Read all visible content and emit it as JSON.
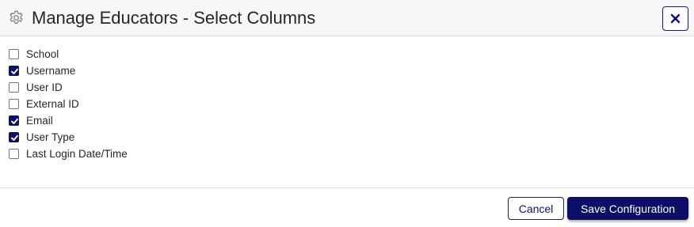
{
  "dialog": {
    "title": "Manage Educators - Select Columns",
    "title_icon": "gear-icon",
    "close_icon": "close-icon"
  },
  "columns": [
    {
      "label": "School",
      "checked": false
    },
    {
      "label": "Username",
      "checked": true
    },
    {
      "label": "User ID",
      "checked": false
    },
    {
      "label": "External ID",
      "checked": false
    },
    {
      "label": "Email",
      "checked": true
    },
    {
      "label": "User Type",
      "checked": true
    },
    {
      "label": "Last Login Date/Time",
      "checked": false
    }
  ],
  "footer": {
    "cancel_label": "Cancel",
    "save_label": "Save Configuration"
  },
  "colors": {
    "primary": "#0c0f66",
    "header_bg": "#f7f7f7"
  }
}
